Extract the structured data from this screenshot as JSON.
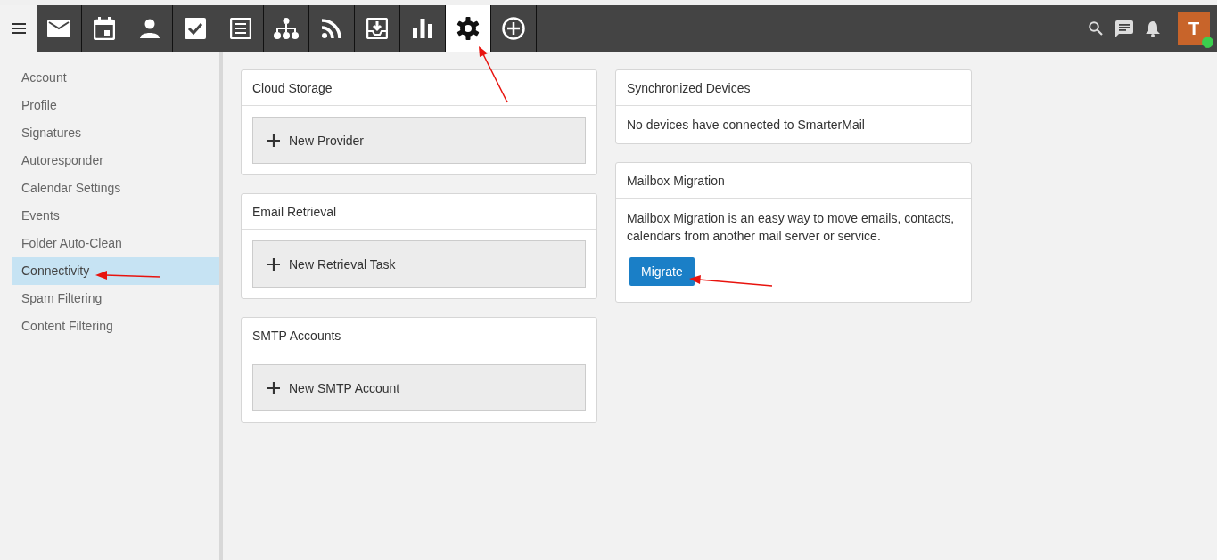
{
  "nav_tabs": [
    {
      "kind": "mail",
      "selected": false
    },
    {
      "kind": "calendar",
      "selected": false
    },
    {
      "kind": "contacts",
      "selected": false
    },
    {
      "kind": "tasks",
      "selected": false
    },
    {
      "kind": "notes",
      "selected": false
    },
    {
      "kind": "org",
      "selected": false
    },
    {
      "kind": "rss",
      "selected": false
    },
    {
      "kind": "inbox",
      "selected": false
    },
    {
      "kind": "chart",
      "selected": false
    },
    {
      "kind": "settings",
      "selected": true
    },
    {
      "kind": "add",
      "selected": false
    }
  ],
  "user": {
    "initial": "T",
    "online": true
  },
  "sidebar": {
    "items": [
      {
        "label": "Account",
        "selected": false
      },
      {
        "label": "Profile",
        "selected": false
      },
      {
        "label": "Signatures",
        "selected": false
      },
      {
        "label": "Autoresponder",
        "selected": false
      },
      {
        "label": "Calendar Settings",
        "selected": false
      },
      {
        "label": "Events",
        "selected": false
      },
      {
        "label": "Folder Auto-Clean",
        "selected": false
      },
      {
        "label": "Connectivity",
        "selected": true
      },
      {
        "label": "Spam Filtering",
        "selected": false
      },
      {
        "label": "Content Filtering",
        "selected": false
      }
    ]
  },
  "left_cards": [
    {
      "title": "Cloud Storage",
      "button": "New Provider"
    },
    {
      "title": "Email Retrieval",
      "button": "New Retrieval Task"
    },
    {
      "title": "SMTP Accounts",
      "button": "New SMTP Account"
    }
  ],
  "synchronized_devices": {
    "title": "Synchronized Devices",
    "message": "No devices have connected to SmarterMail"
  },
  "mailbox_migration": {
    "title": "Mailbox Migration",
    "description": "Mailbox Migration is an easy way to move emails, contacts, calendars from another mail server or service.",
    "button": "Migrate"
  }
}
